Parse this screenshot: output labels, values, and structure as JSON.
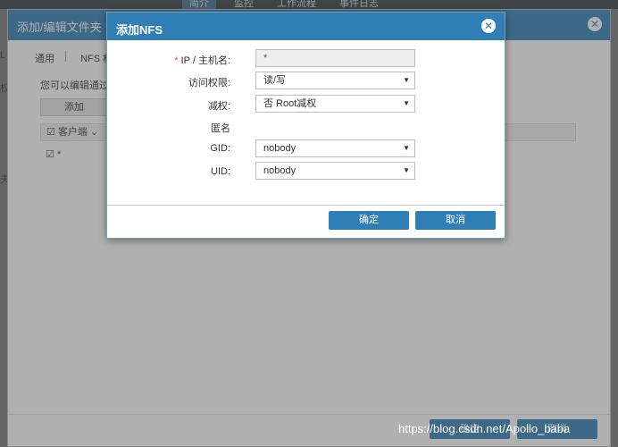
{
  "app": {
    "nav": [
      "简介",
      "监控",
      "工作流程",
      "事件日志"
    ]
  },
  "outer_dialog": {
    "title": "添加/编辑文件夹",
    "tabs": [
      "通用",
      "NFS 权"
    ],
    "description": "您可以编辑通过",
    "add_label": "添加",
    "table_header": "客户端",
    "row_value": "*",
    "left_texts": [
      "L",
      "权",
      "夫"
    ],
    "ok_label": "确定",
    "cancel_label": "取消"
  },
  "modal": {
    "title": "添加NFS",
    "close_icon": "close-circle-icon",
    "required_mark": "*",
    "host_label": "IP / 主机名:",
    "host_value": "*",
    "access_label": "访问权限:",
    "access_value": "读/写",
    "squash_label": "减权:",
    "squash_value": "否 Root减权",
    "anon_label": "匿名",
    "gid_label": "GID:",
    "gid_value": "nobody",
    "uid_label": "UID:",
    "uid_value": "nobody",
    "ok_label": "确定",
    "cancel_label": "取消"
  },
  "watermark": "https://blog.csdn.net/Apollo_baba",
  "colors": {
    "header": "#2f7eb6",
    "required": "#e05a2b",
    "button": "#2f7eb6"
  }
}
